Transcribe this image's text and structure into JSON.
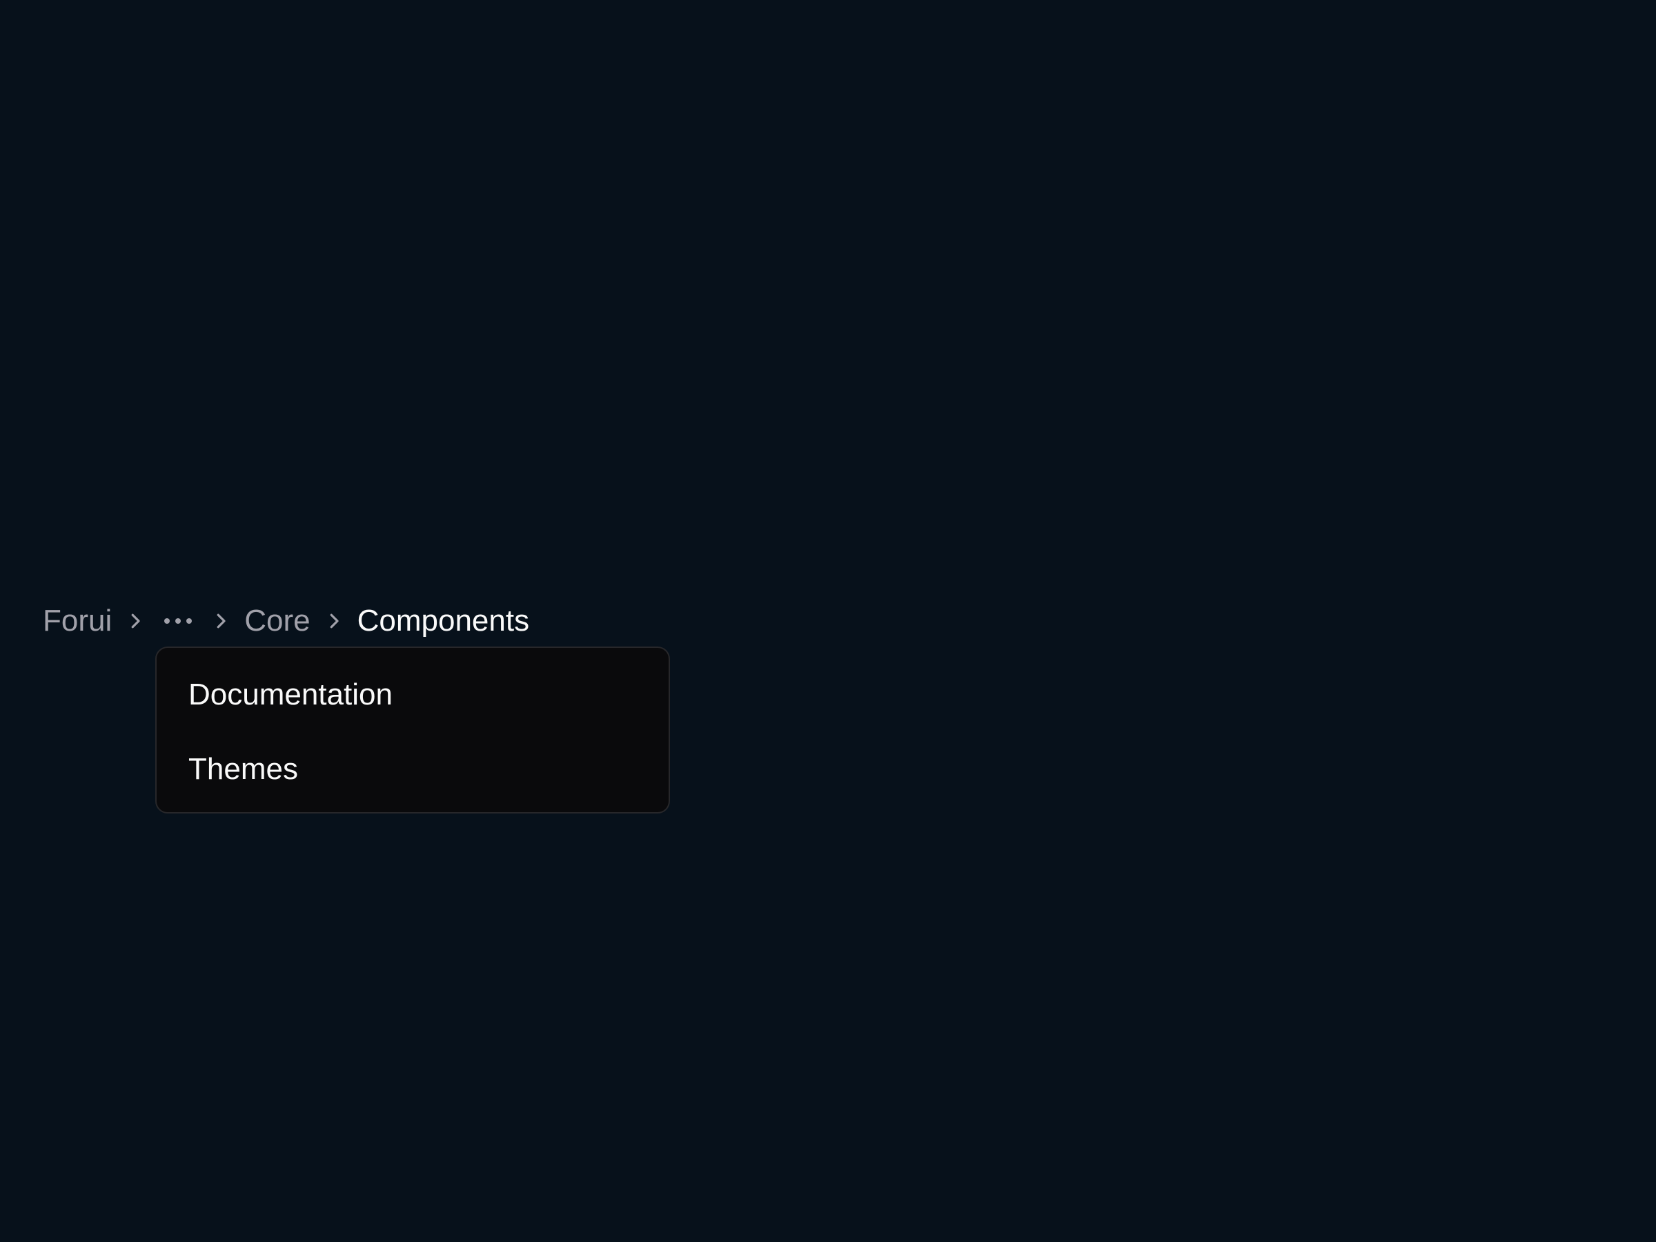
{
  "theme": {
    "background": "#07111b",
    "muted_text": "#a1a1aa",
    "active_text": "#fafafa",
    "menu_background": "#0a0a0c",
    "menu_border": "#27272a"
  },
  "breadcrumb": {
    "items": [
      {
        "label": "Forui",
        "current": false
      },
      {
        "label": "Core",
        "current": false
      },
      {
        "label": "Components",
        "current": true
      }
    ],
    "separator_icon": "chevron-right-icon",
    "collapsed_icon": "ellipsis-icon"
  },
  "collapsed_menu": {
    "open": true,
    "items": [
      {
        "label": "Documentation"
      },
      {
        "label": "Themes"
      }
    ]
  }
}
